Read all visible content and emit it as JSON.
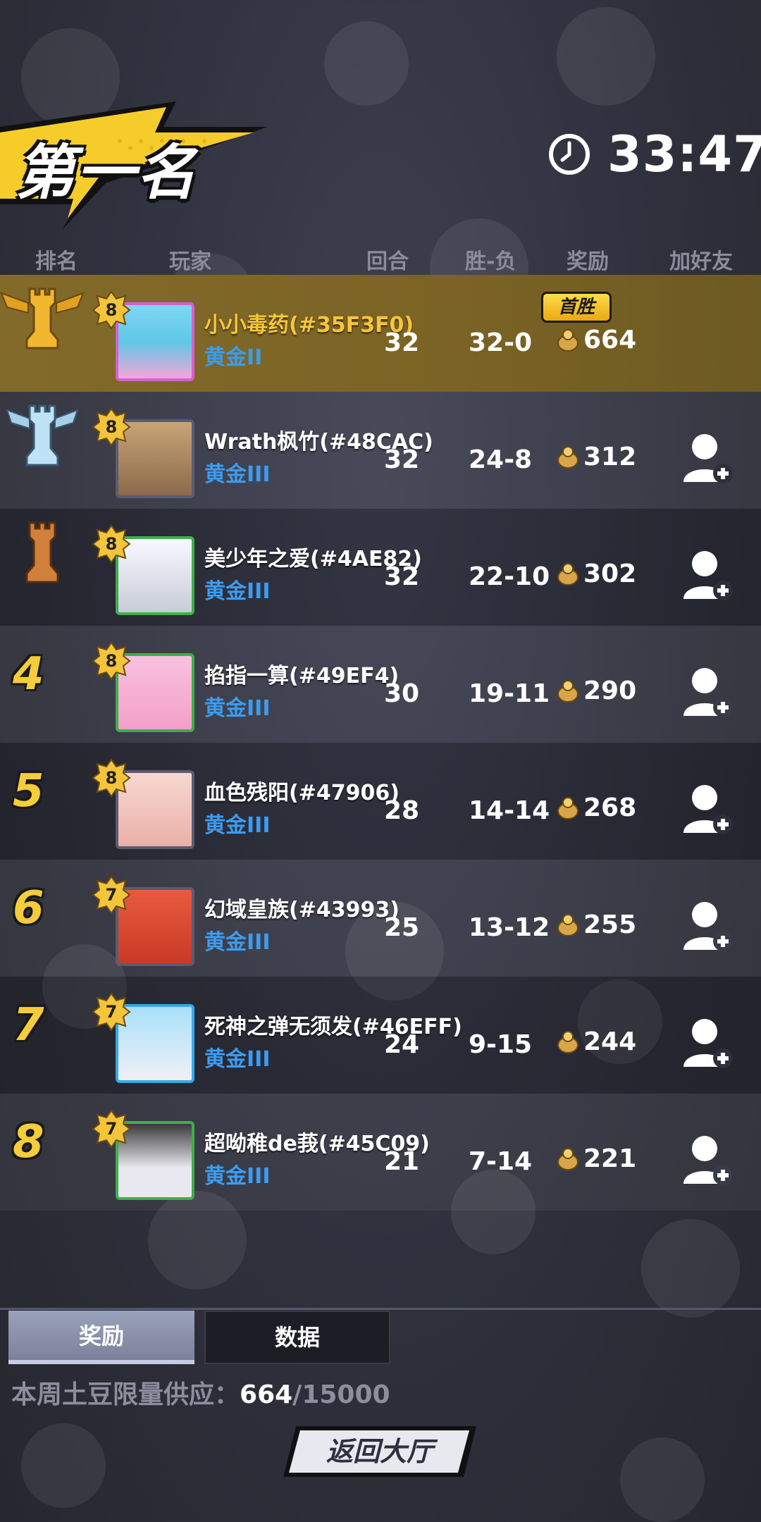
{
  "header": {
    "placement_title": "第一名",
    "timer": "33:47"
  },
  "columns": [
    "排名",
    "玩家",
    "回合",
    "胜-负",
    "奖励",
    "加好友"
  ],
  "first_win_label": "首胜",
  "players": [
    {
      "rank": "1",
      "level": "8",
      "name": "小小毒药(#35F3F0)",
      "tier": "黄金II",
      "rounds": "32",
      "wl": "32-0",
      "reward": "664",
      "is_self": true
    },
    {
      "rank": "2",
      "level": "8",
      "name": "Wrath枫竹(#48CAC)",
      "tier": "黄金III",
      "rounds": "32",
      "wl": "24-8",
      "reward": "312",
      "is_self": false
    },
    {
      "rank": "3",
      "level": "8",
      "name": "美少年之爱(#4AE82)",
      "tier": "黄金III",
      "rounds": "32",
      "wl": "22-10",
      "reward": "302",
      "is_self": false
    },
    {
      "rank": "4",
      "level": "8",
      "name": "掐指一算(#49EF4)",
      "tier": "黄金III",
      "rounds": "30",
      "wl": "19-11",
      "reward": "290",
      "is_self": false
    },
    {
      "rank": "5",
      "level": "8",
      "name": "血色残阳(#47906)",
      "tier": "黄金III",
      "rounds": "28",
      "wl": "14-14",
      "reward": "268",
      "is_self": false
    },
    {
      "rank": "6",
      "level": "7",
      "name": "幻域皇族(#43993)",
      "tier": "黄金III",
      "rounds": "25",
      "wl": "13-12",
      "reward": "255",
      "is_self": false
    },
    {
      "rank": "7",
      "level": "7",
      "name": "死神之弹无须发(#46EFF)",
      "tier": "黄金III",
      "rounds": "24",
      "wl": "9-15",
      "reward": "244",
      "is_self": false
    },
    {
      "rank": "8",
      "level": "7",
      "name": "超呦稚de莪(#45C09)",
      "tier": "黄金III",
      "rounds": "21",
      "wl": "7-14",
      "reward": "221",
      "is_self": false
    }
  ],
  "tabs": {
    "reward": "奖励",
    "data": "数据",
    "active": "reward"
  },
  "supply": {
    "label": "本周土豆限量供应：",
    "current": "664",
    "total": "/15000"
  },
  "back_button": "返回大厅",
  "colors": {
    "gold": "#f5cd3a",
    "tier_blue": "#3c9cf0",
    "highlight_row": "#7a6324"
  },
  "avatar_colors": [
    "#5fc7e8",
    "#8a6a4a",
    "#e8e8f0",
    "#f4a0c8",
    "#f3c8c0",
    "#d8402c",
    "#f0f0f8",
    "#e8e8ee"
  ],
  "avatar_frames": [
    "#d75fd0",
    "#5a5c70",
    "#3fae4a",
    "#3fae4a",
    "#5a5c70",
    "#5a5c70",
    "#38a8e8",
    "#3fae4a"
  ]
}
